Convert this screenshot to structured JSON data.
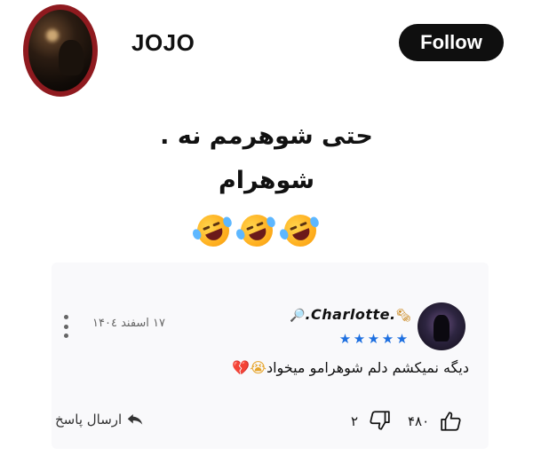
{
  "header": {
    "username": "JOJO",
    "follow_label": "Follow"
  },
  "post": {
    "line1": "حتی شوهرمم نه .",
    "line2": "شوهرام",
    "emojis": [
      "rolling-on-floor-laughing",
      "rolling-on-floor-laughing",
      "rolling-on-floor-laughing"
    ]
  },
  "comment": {
    "author_name": ".Charlotte.",
    "author_prefix_icon": "magnifier-icon",
    "author_suffix_icon": "newspaper-icon",
    "stars": 5,
    "date": "۱۷ اسفند ۱۴۰٤",
    "body_text": "دیگه نمیکشم دلم شوهرامو میخواد",
    "body_emojis": [
      "loudly-crying-face",
      "broken-heart"
    ],
    "likes": "۴۸۰",
    "dislikes": "۲",
    "reply_label": "ارسال پاسخ"
  },
  "colors": {
    "avatar_ring": "#8f1a1f",
    "follow_bg": "#0f0f0f",
    "star": "#1d6fe0",
    "card_bg": "#f9f9fb"
  }
}
